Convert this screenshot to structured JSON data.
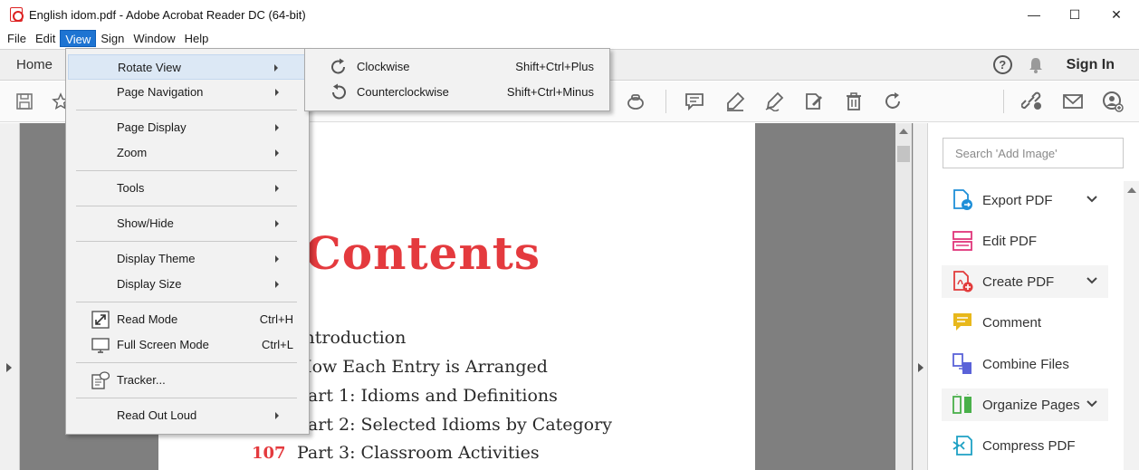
{
  "window": {
    "title": "English idom.pdf - Adobe Acrobat Reader DC (64-bit)",
    "minimize": "—",
    "maximize": "☐",
    "close": "✕"
  },
  "menubar": [
    "File",
    "Edit",
    "View",
    "Sign",
    "Window",
    "Help"
  ],
  "navbar": {
    "home": "Home",
    "signin": "Sign In",
    "help": "?"
  },
  "view_menu": {
    "items": [
      {
        "label": "Rotate View",
        "shortcut": "",
        "submenu": true
      },
      {
        "label": "Page Navigation",
        "shortcut": "",
        "submenu": true
      },
      {
        "label": "Page Display",
        "shortcut": "",
        "submenu": true
      },
      {
        "label": "Zoom",
        "shortcut": "",
        "submenu": true
      },
      {
        "label": "Tools",
        "shortcut": "",
        "submenu": true
      },
      {
        "label": "Show/Hide",
        "shortcut": "",
        "submenu": true
      },
      {
        "label": "Display Theme",
        "shortcut": "",
        "submenu": true
      },
      {
        "label": "Display Size",
        "shortcut": "",
        "submenu": true
      },
      {
        "label": "Read Mode",
        "shortcut": "Ctrl+H",
        "submenu": false
      },
      {
        "label": "Full Screen Mode",
        "shortcut": "Ctrl+L",
        "submenu": false
      },
      {
        "label": "Tracker...",
        "shortcut": "",
        "submenu": false
      },
      {
        "label": "Read Out Loud",
        "shortcut": "",
        "submenu": true
      }
    ]
  },
  "rotate_submenu": {
    "items": [
      {
        "label": "Clockwise",
        "shortcut": "Shift+Ctrl+Plus"
      },
      {
        "label": "Counterclockwise",
        "shortcut": "Shift+Ctrl+Minus"
      }
    ]
  },
  "document": {
    "heading": "Contents",
    "toc": [
      {
        "num": "",
        "text": "Introduction"
      },
      {
        "num": "",
        "text": "How Each Entry is Arranged"
      },
      {
        "num": "",
        "text": "Part 1: Idioms and Definitions"
      },
      {
        "num": "",
        "text": "Part 2: Selected Idioms by Category"
      },
      {
        "num": "107",
        "text": "Part 3: Classroom Activities"
      }
    ]
  },
  "right_pane": {
    "search_placeholder": "Search 'Add Image'",
    "tools": [
      {
        "label": "Export PDF",
        "icon": "export-pdf-icon",
        "color": "#1e8fd8",
        "expand": true
      },
      {
        "label": "Edit PDF",
        "icon": "edit-pdf-icon",
        "color": "#e0357a",
        "expand": false
      },
      {
        "label": "Create PDF",
        "icon": "create-pdf-icon",
        "color": "#e23b3b",
        "expand": true
      },
      {
        "label": "Comment",
        "icon": "comment-icon",
        "color": "#e8b81c",
        "expand": false
      },
      {
        "label": "Combine Files",
        "icon": "combine-files-icon",
        "color": "#5a62d8",
        "expand": false
      },
      {
        "label": "Organize Pages",
        "icon": "organize-pages-icon",
        "color": "#49b04a",
        "expand": true
      },
      {
        "label": "Compress PDF",
        "icon": "compress-pdf-icon",
        "color": "#1ea1c4",
        "expand": false
      }
    ]
  },
  "colors": {
    "accent": "#1e74d2",
    "heading_red": "#e43a3e"
  }
}
